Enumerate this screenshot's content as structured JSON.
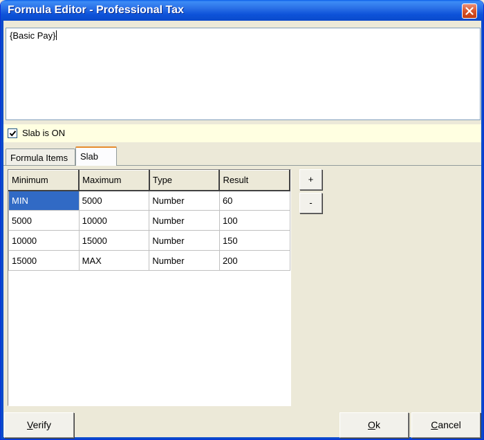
{
  "window": {
    "title": "Formula Editor - Professional Tax",
    "colors": {
      "titlebar": "#0a4acb",
      "close": "#d9542a",
      "selection": "#316ac5"
    }
  },
  "formula": {
    "text": "{Basic Pay}"
  },
  "slab_toggle": {
    "label": "Slab is ON",
    "checked": true
  },
  "tabs": [
    {
      "label": "Formula Items",
      "active": false
    },
    {
      "label": "Slab",
      "active": true
    }
  ],
  "grid": {
    "columns": [
      "Minimum",
      "Maximum",
      "Type",
      "Result"
    ],
    "rows": [
      [
        "MIN",
        "5000",
        "Number",
        "60"
      ],
      [
        "5000",
        "10000",
        "Number",
        "100"
      ],
      [
        "10000",
        "15000",
        "Number",
        "150"
      ],
      [
        "15000",
        "MAX",
        "Number",
        "200"
      ]
    ],
    "selected_cell": "MIN"
  },
  "row_buttons": {
    "add_label": "+",
    "remove_label": "-"
  },
  "footer": {
    "verify_label": "Verify",
    "ok_label": "Ok",
    "cancel_label": "Cancel"
  }
}
